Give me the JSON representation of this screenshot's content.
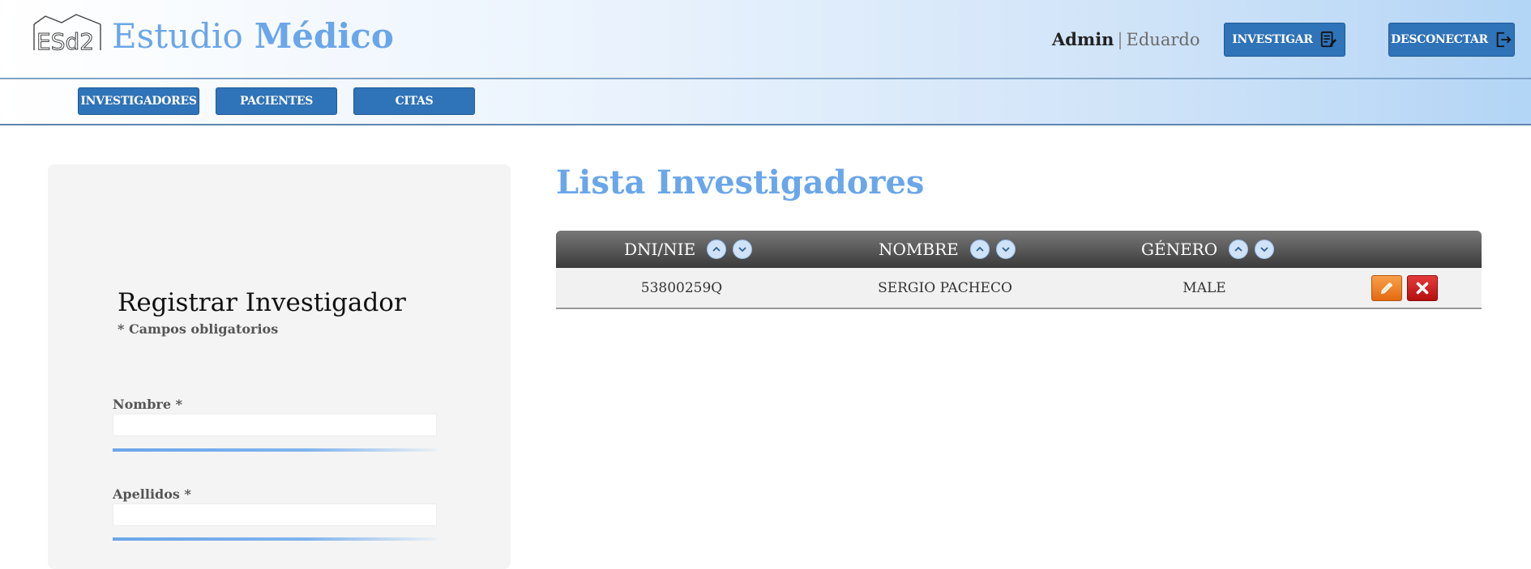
{
  "header": {
    "brand_word1": "Estudio",
    "brand_word2": "Médico",
    "user_role": "Admin",
    "user_separator": "|",
    "user_name": "Eduardo",
    "investigar_label": "INVESTIGAR",
    "desconectar_label": "DESCONECTAR"
  },
  "nav": {
    "items": [
      {
        "label": "INVESTIGADORES"
      },
      {
        "label": "PACIENTES"
      },
      {
        "label": "CITAS"
      }
    ]
  },
  "form": {
    "title": "Registrar Investigador",
    "note": "* Campos obligatorios",
    "fields": [
      {
        "label": "Nombre *",
        "value": "",
        "placeholder": ""
      },
      {
        "label": "Apellidos *",
        "value": "",
        "placeholder": ""
      }
    ]
  },
  "list": {
    "title": "Lista Investigadores",
    "columns": [
      {
        "label": "DNI/NIE"
      },
      {
        "label": "NOMBRE"
      },
      {
        "label": "GÉNERO"
      }
    ],
    "rows": [
      {
        "dni": "53800259Q",
        "nombre": "SERGIO PACHECO",
        "genero": "MALE"
      }
    ]
  },
  "icons": {
    "investigar": "document-edit-icon",
    "desconectar": "logout-icon",
    "sort_asc": "chevron-up-icon",
    "sort_desc": "chevron-down-icon",
    "edit": "pencil-icon",
    "delete": "close-icon"
  },
  "colors": {
    "accent": "#6aa6ea",
    "button": "#2f73b8",
    "edit": "#f28a2c",
    "delete": "#d11f1f"
  }
}
